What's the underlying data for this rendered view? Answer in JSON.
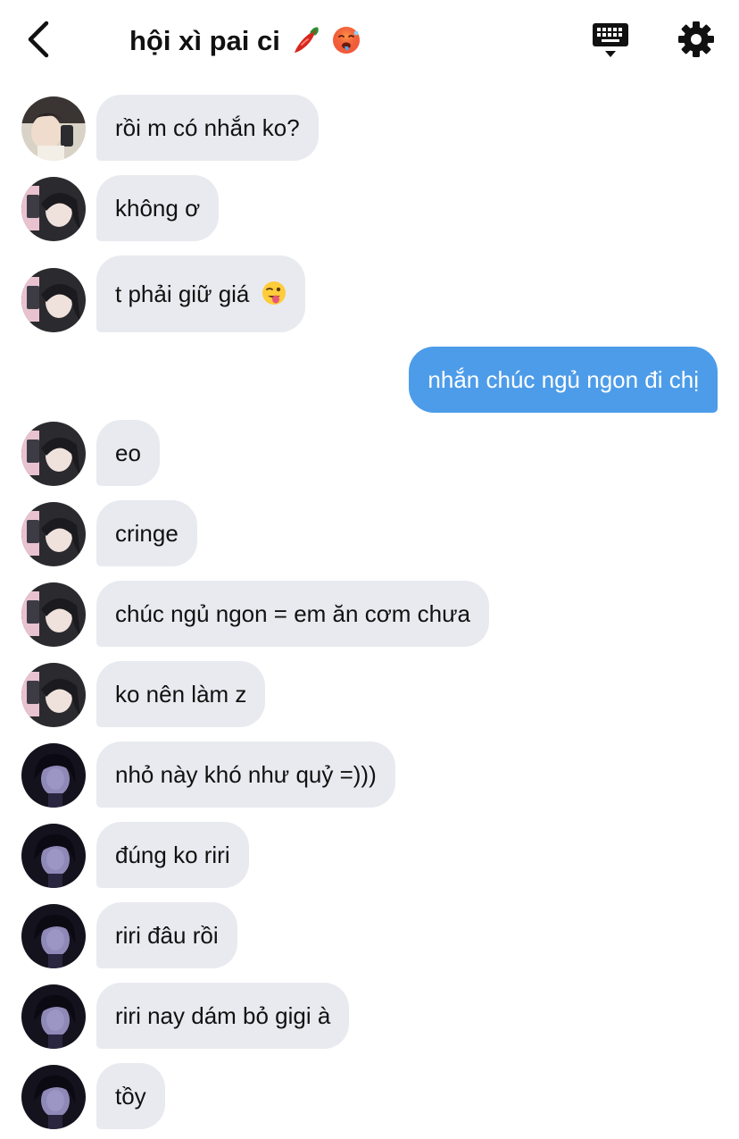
{
  "header": {
    "title": "hội xì pai ci",
    "title_emojis": [
      "chili-pepper-emoji",
      "hot-face-emoji"
    ],
    "back_icon": "chevron-left-icon",
    "keyboard_icon": "keyboard-icon",
    "settings_icon": "gear-icon"
  },
  "colors": {
    "incoming_bubble": "#e8eaef",
    "outgoing_bubble": "#4d9ce9",
    "text": "#111111"
  },
  "messages": [
    {
      "text": "rồi m có nhắn ko?",
      "sender": "member-1"
    },
    {
      "text": "không ơ",
      "sender": "member-2"
    },
    {
      "text": "t phải giữ giá",
      "sender": "member-2",
      "emoji": "winking-face-with-tongue-emoji"
    },
    {
      "text": "nhắn chúc ngủ ngon đi chị",
      "sender": "me"
    },
    {
      "text": "eo",
      "sender": "member-2"
    },
    {
      "text": "cringe",
      "sender": "member-2"
    },
    {
      "text": "chúc ngủ ngon = em ăn cơm chưa",
      "sender": "member-2"
    },
    {
      "text": "ko nên làm z",
      "sender": "member-2"
    },
    {
      "text": "nhỏ này khó như quỷ =)))",
      "sender": "member-3"
    },
    {
      "text": "đúng ko riri",
      "sender": "member-3"
    },
    {
      "text": "riri đâu rồi",
      "sender": "member-3"
    },
    {
      "text": "riri nay dám bỏ gigi à",
      "sender": "member-3"
    },
    {
      "text": "tồy",
      "sender": "member-3"
    }
  ]
}
